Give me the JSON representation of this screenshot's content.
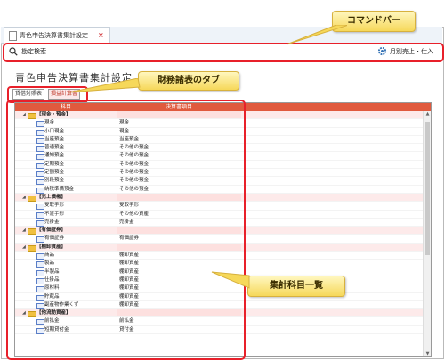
{
  "window": {
    "tab_title": "青色申告決算書集計設定",
    "tab_close": "×"
  },
  "command_bar": {
    "search_label": "勘定検索",
    "option_label": "月別売上・仕入"
  },
  "page_title": "青色申告決算書集計設定",
  "fs_tabs": [
    "貸借対照表",
    "損益計算書"
  ],
  "grid": {
    "headers": [
      "科目",
      "決算書項目"
    ],
    "rows": [
      {
        "type": "group",
        "label": "【現金・預金】",
        "value": ""
      },
      {
        "type": "item",
        "label": "現金",
        "value": "現金"
      },
      {
        "type": "item",
        "label": "小口現金",
        "value": "現金"
      },
      {
        "type": "item",
        "label": "当座預金",
        "value": "当座預金"
      },
      {
        "type": "item",
        "label": "普通預金",
        "value": "その他の預金"
      },
      {
        "type": "item",
        "label": "通知預金",
        "value": "その他の預金"
      },
      {
        "type": "item",
        "label": "定期預金",
        "value": "その他の預金"
      },
      {
        "type": "item",
        "label": "定額預金",
        "value": "その他の預金"
      },
      {
        "type": "item",
        "label": "別段預金",
        "value": "その他の預金"
      },
      {
        "type": "item",
        "label": "納税準備預金",
        "value": "その他の預金"
      },
      {
        "type": "group",
        "label": "【売上債権】",
        "value": ""
      },
      {
        "type": "item",
        "label": "受取手形",
        "value": "受取手形"
      },
      {
        "type": "item",
        "label": "不渡手形",
        "value": "その他の資産"
      },
      {
        "type": "item",
        "label": "売掛金",
        "value": "売掛金"
      },
      {
        "type": "group",
        "label": "【有価証券】",
        "value": ""
      },
      {
        "type": "item",
        "label": "有価証券",
        "value": "有価証券"
      },
      {
        "type": "group",
        "label": "【棚卸資産】",
        "value": ""
      },
      {
        "type": "item",
        "label": "商品",
        "value": "棚卸資産"
      },
      {
        "type": "item",
        "label": "製品",
        "value": "棚卸資産"
      },
      {
        "type": "item",
        "label": "半製品",
        "value": "棚卸資産"
      },
      {
        "type": "item",
        "label": "仕掛品",
        "value": "棚卸資産"
      },
      {
        "type": "item",
        "label": "原材料",
        "value": "棚卸資産"
      },
      {
        "type": "item",
        "label": "貯蔵品",
        "value": "棚卸資産"
      },
      {
        "type": "item",
        "label": "副産物作業くず",
        "value": "棚卸資産"
      },
      {
        "type": "group",
        "label": "【他流動資産】",
        "value": ""
      },
      {
        "type": "item",
        "label": "前払金",
        "value": "前払金"
      },
      {
        "type": "item",
        "label": "短期貸付金",
        "value": "貸付金"
      }
    ]
  },
  "callouts": {
    "command_bar": "コマンドバー",
    "fs_tabs": "財務諸表のタブ",
    "summary_list": "集計科目一覧"
  }
}
